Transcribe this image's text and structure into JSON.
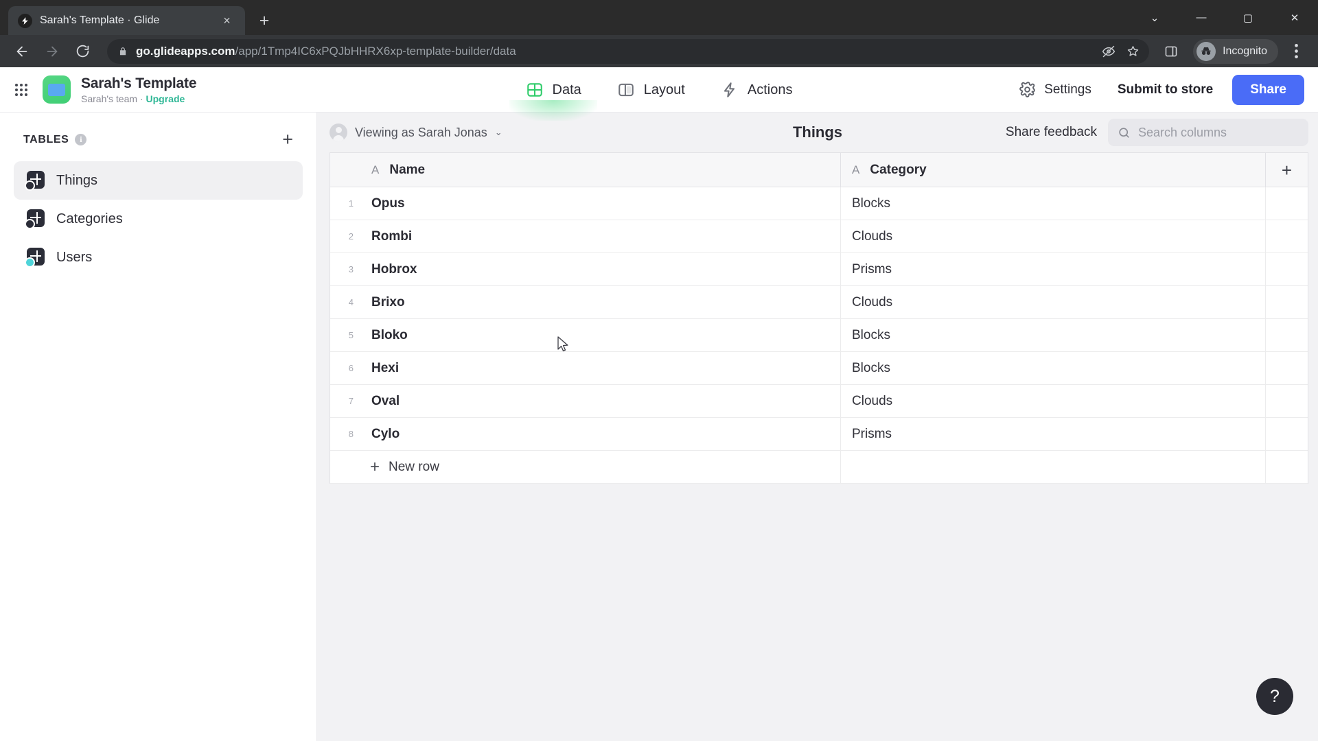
{
  "browser": {
    "tab": {
      "title": "Sarah's Template · Glide",
      "favicon": "glide-bolt-icon",
      "close": "×"
    },
    "new_tab": "+",
    "window_controls": {
      "minimize_group": "⌄",
      "minimize": "—",
      "maximize": "▢",
      "close": "✕"
    },
    "nav": {
      "back": "back-icon",
      "forward": "forward-icon",
      "reload": "reload-icon"
    },
    "omnibox": {
      "host": "go.glideapps.com",
      "path": "/app/1Tmp4IC6xPQJbHHRX6xp-template-builder/data",
      "lock": "lock-icon",
      "third_party_cookies": "eye-slash-icon",
      "bookmark": "star-icon"
    },
    "side_panel": "side-panel-icon",
    "profile": {
      "label": "Incognito",
      "icon": "incognito-icon"
    },
    "menu": "kebab-menu-icon"
  },
  "app": {
    "apps_grid": "apps-grid-icon",
    "icon": "app-thumbnail-icon",
    "title": "Sarah's Template",
    "team": "Sarah's team",
    "separator": "·",
    "upgrade": "Upgrade",
    "tabs": [
      {
        "label": "Data",
        "icon": "grid-table-icon",
        "active": true
      },
      {
        "label": "Layout",
        "icon": "layout-panels-icon",
        "active": false
      },
      {
        "label": "Actions",
        "icon": "lightning-bolt-icon",
        "active": false
      }
    ],
    "settings": {
      "label": "Settings",
      "icon": "gear-icon"
    },
    "submit_to_store": "Submit to store",
    "share": "Share",
    "share_color": "#4a6cf7"
  },
  "sidebar": {
    "heading": "TABLES",
    "info": "i",
    "add": "+",
    "items": [
      {
        "label": "Things",
        "icon": "table-icon",
        "selected": true,
        "badge": "clock-badge"
      },
      {
        "label": "Categories",
        "icon": "table-icon",
        "selected": false,
        "badge": "clock-badge"
      },
      {
        "label": "Users",
        "icon": "table-icon",
        "selected": false,
        "badge": "user-badge"
      }
    ]
  },
  "main": {
    "viewing_as": "Viewing as Sarah Jonas",
    "viewing_caret": "⌄",
    "avatar": "user-avatar-icon",
    "title": "Things",
    "share_feedback": "Share feedback",
    "search": {
      "placeholder": "Search columns",
      "value": "",
      "icon": "search-icon"
    },
    "add_column": "+",
    "new_row": {
      "label": "New row",
      "plus": "+"
    },
    "columns": [
      {
        "label": "Name",
        "type": "A"
      },
      {
        "label": "Category",
        "type": "A"
      }
    ],
    "rows": [
      {
        "n": "1",
        "name": "Opus",
        "category": "Blocks"
      },
      {
        "n": "2",
        "name": "Rombi",
        "category": "Clouds"
      },
      {
        "n": "3",
        "name": "Hobrox",
        "category": "Prisms"
      },
      {
        "n": "4",
        "name": "Brixo",
        "category": "Clouds"
      },
      {
        "n": "5",
        "name": "Bloko",
        "category": "Blocks"
      },
      {
        "n": "6",
        "name": "Hexi",
        "category": "Blocks"
      },
      {
        "n": "7",
        "name": "Oval",
        "category": "Clouds"
      },
      {
        "n": "8",
        "name": "Cylo",
        "category": "Prisms"
      }
    ]
  },
  "help": {
    "label": "?"
  }
}
